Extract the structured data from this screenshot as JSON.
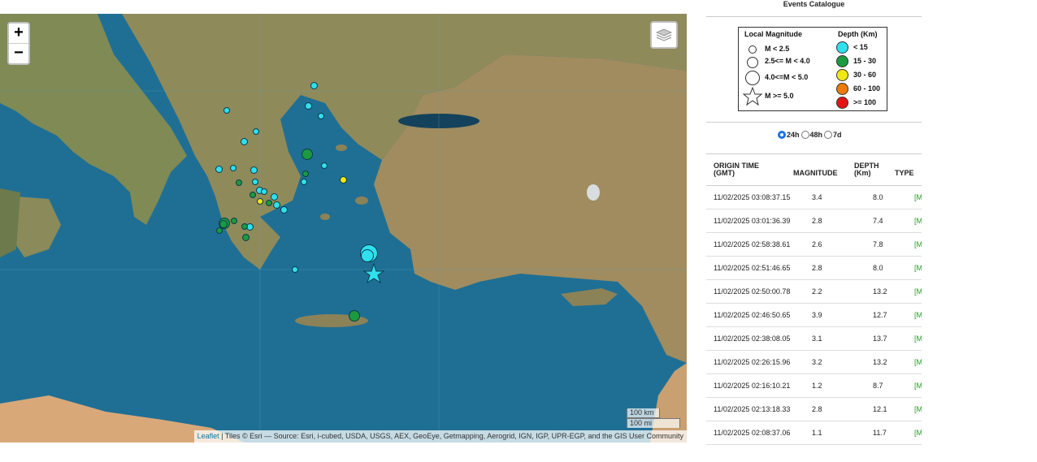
{
  "map": {
    "zoom_in": "+",
    "zoom_out": "−",
    "layers_icon": "layers-icon",
    "scale_km": "100 km",
    "scale_mi": "100 mi",
    "attribution_link": "Leaflet",
    "attribution_text": " | Tiles © Esri — Source: Esri, i-cubed, USDA, USGS, AEX, GeoEye, Getmapping, Aerogrid, IGN, IGP, UPR-EGP, and the GIS User Community",
    "colors": {
      "sea": "#1f6f95",
      "land": "#9c8a5c",
      "shallow": "#3c9cb8",
      "shallow_depth": "#27c9d6",
      "mid_depth": "#1f9a4a",
      "deep": "#e3d21a"
    }
  },
  "panel": {
    "title": "Events Catalogue",
    "legend": {
      "magnitude_header": "Local Magnitude",
      "depth_header": "Depth (Km)",
      "magnitudes": [
        "M < 2.5",
        "2.5<= M < 4.0",
        "4.0<=M < 5.0",
        "M >= 5.0"
      ],
      "depths": [
        {
          "label": "< 15",
          "color": "#2fe0ee"
        },
        {
          "label": "15 - 30",
          "color": "#1b9a3e"
        },
        {
          "label": "30 - 60",
          "color": "#f1e80f"
        },
        {
          "label": "60 - 100",
          "color": "#f07a07"
        },
        {
          "label": ">= 100",
          "color": "#e41414"
        }
      ]
    },
    "ranges": [
      {
        "label": "24h",
        "selected": true
      },
      {
        "label": "48h",
        "selected": false
      },
      {
        "label": "7d",
        "selected": false
      }
    ],
    "table": {
      "headers": {
        "time_1": "ORIGIN TIME",
        "time_2": "(GMT)",
        "magnitude": "MAGNITUDE",
        "depth_1": "DEPTH",
        "depth_2": "(Km)",
        "type": "TYPE"
      },
      "rows": [
        {
          "time": "11/02/2025 03:08:37.15",
          "mag": "3.4",
          "depth": "8.0",
          "type": "[M"
        },
        {
          "time": "11/02/2025 03:01:36.39",
          "mag": "2.8",
          "depth": "7.4",
          "type": "[M"
        },
        {
          "time": "11/02/2025 02:58:38.61",
          "mag": "2.6",
          "depth": "7.8",
          "type": "[M"
        },
        {
          "time": "11/02/2025 02:51:46.65",
          "mag": "2.8",
          "depth": "8.0",
          "type": "[M"
        },
        {
          "time": "11/02/2025 02:50:00.78",
          "mag": "2.2",
          "depth": "13.2",
          "type": "[M"
        },
        {
          "time": "11/02/2025 02:46:50.65",
          "mag": "3.9",
          "depth": "12.7",
          "type": "[M"
        },
        {
          "time": "11/02/2025 02:38:08.05",
          "mag": "3.1",
          "depth": "13.7",
          "type": "[M"
        },
        {
          "time": "11/02/2025 02:26:15.96",
          "mag": "3.2",
          "depth": "13.2",
          "type": "[M"
        },
        {
          "time": "11/02/2025 02:16:10.21",
          "mag": "1.2",
          "depth": "8.7",
          "type": "[M"
        },
        {
          "time": "11/02/2025 02:13:18.33",
          "mag": "2.8",
          "depth": "12.1",
          "type": "[M"
        },
        {
          "time": "11/02/2025 02:08:37.06",
          "mag": "1.1",
          "depth": "11.7",
          "type": "[M"
        }
      ]
    }
  }
}
